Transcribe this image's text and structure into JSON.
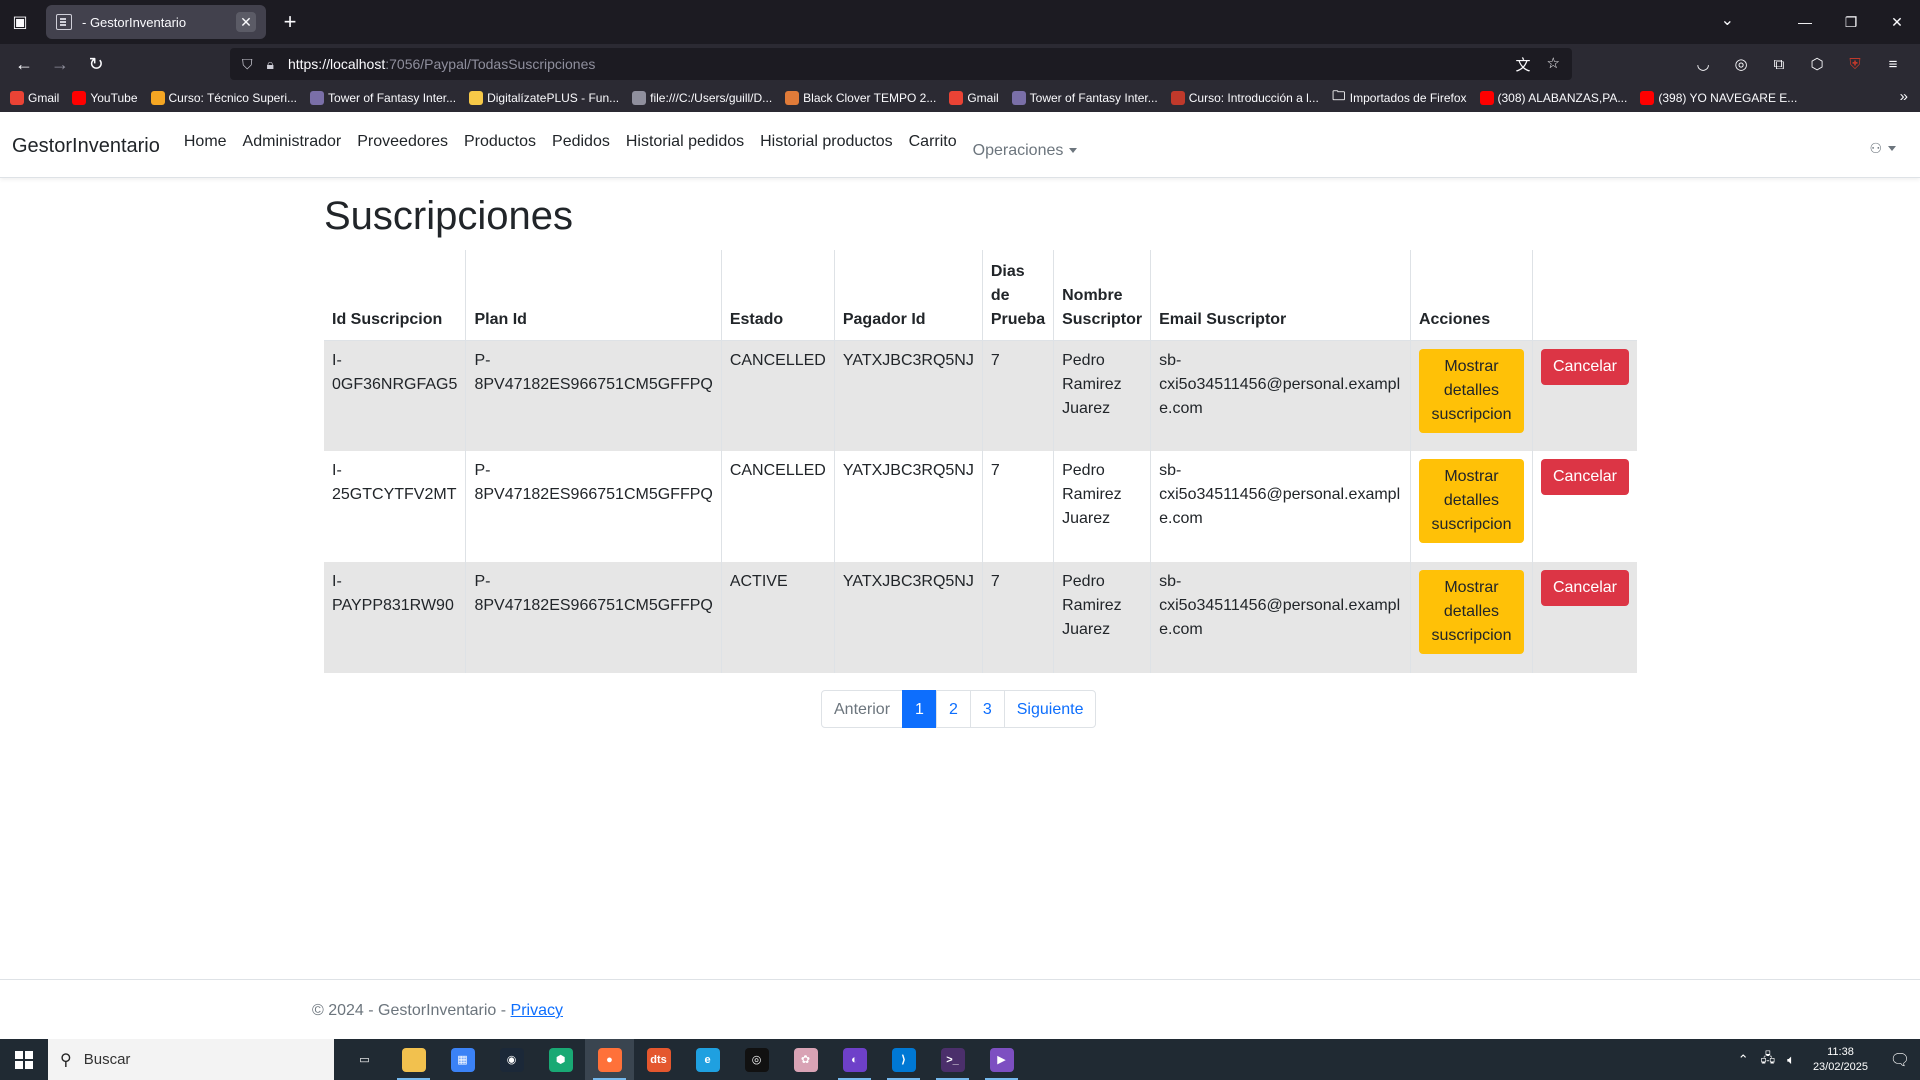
{
  "browser": {
    "tab_title": "- GestorInventario",
    "url_host": "https://localhost",
    "url_rest": ":7056/Paypal/TodasSuscripciones",
    "bookmarks": [
      {
        "label": "Gmail",
        "color": "#ea4335",
        "icon": "gmail-icon"
      },
      {
        "label": "YouTube",
        "color": "#ff0000",
        "icon": "youtube-icon"
      },
      {
        "label": "Curso: Técnico Superi...",
        "color": "#f5a623",
        "icon": "course-icon"
      },
      {
        "label": "Tower of Fantasy Inter...",
        "color": "#7a6fa8",
        "icon": "game-icon"
      },
      {
        "label": "DigitalízatePLUS - Fun...",
        "color": "#f7c948",
        "icon": "digital-icon"
      },
      {
        "label": "file:///C:/Users/guill/D...",
        "color": "#8f8f9d",
        "icon": "globe-icon"
      },
      {
        "label": "Black Clover TEMPO 2...",
        "color": "#e07b39",
        "icon": "fox-icon"
      },
      {
        "label": "Gmail",
        "color": "#ea4335",
        "icon": "gmail-icon"
      },
      {
        "label": "Tower of Fantasy Inter...",
        "color": "#7a6fa8",
        "icon": "game-icon"
      },
      {
        "label": "Curso: Introducción a l...",
        "color": "#c0392b",
        "icon": "course-icon"
      },
      {
        "label": "Importados de Firefox",
        "color": "transparent",
        "icon": "folder-icon"
      },
      {
        "label": "(308) ALABANZAS,PA...",
        "color": "#ff0000",
        "icon": "youtube-icon"
      },
      {
        "label": "(398) YO NAVEGARE E...",
        "color": "#ff0000",
        "icon": "youtube-icon"
      }
    ]
  },
  "site": {
    "brand": "GestorInventario",
    "nav": [
      "Home",
      "Administrador",
      "Proveedores",
      "Productos",
      "Pedidos",
      "Historial pedidos",
      "Historial productos",
      "Carrito"
    ],
    "dropdown": "Operaciones"
  },
  "page": {
    "title": "Suscripciones",
    "columns": [
      "Id Suscripcion",
      "Plan Id",
      "Estado",
      "Pagador Id",
      "Dias de Prueba",
      "Nombre Suscriptor",
      "Email Suscriptor",
      "Acciones",
      ""
    ],
    "rows": [
      {
        "id": "I-0GF36NRGFAG5",
        "plan": "P-8PV47182ES966751CM5GFFPQ",
        "estado": "CANCELLED",
        "pagador": "YATXJBC3RQ5NJ",
        "dias": "7",
        "nombre": "Pedro Ramirez Juarez",
        "email": "sb-cxi5o34511456@personal.example.com",
        "btn_details": "Mostrar detalles suscripcion",
        "btn_cancel": "Cancelar"
      },
      {
        "id": "I-25GTCYTFV2MT",
        "plan": "P-8PV47182ES966751CM5GFFPQ",
        "estado": "CANCELLED",
        "pagador": "YATXJBC3RQ5NJ",
        "dias": "7",
        "nombre": "Pedro Ramirez Juarez",
        "email": "sb-cxi5o34511456@personal.example.com",
        "btn_details": "Mostrar detalles suscripcion",
        "btn_cancel": "Cancelar"
      },
      {
        "id": "I-PAYPP831RW90",
        "plan": "P-8PV47182ES966751CM5GFFPQ",
        "estado": "ACTIVE",
        "pagador": "YATXJBC3RQ5NJ",
        "dias": "7",
        "nombre": "Pedro Ramirez Juarez",
        "email": "sb-cxi5o34511456@personal.example.com",
        "btn_details": "Mostrar detalles suscripcion",
        "btn_cancel": "Cancelar"
      }
    ],
    "pagination": {
      "prev": "Anterior",
      "pages": [
        "1",
        "2",
        "3"
      ],
      "active": "1",
      "next": "Siguiente"
    }
  },
  "footer": {
    "text": "© 2024 - GestorInventario - ",
    "link": "Privacy"
  },
  "taskbar": {
    "search_placeholder": "Buscar",
    "time": "11:38",
    "date": "23/02/2025",
    "apps": [
      {
        "name": "task-view-icon",
        "color": "transparent",
        "glyph": "▭"
      },
      {
        "name": "file-explorer-icon",
        "color": "#f2c14e",
        "glyph": ""
      },
      {
        "name": "store-icon",
        "color": "#3b82f6",
        "glyph": "▦"
      },
      {
        "name": "steam-icon",
        "color": "#1b2838",
        "glyph": "◉"
      },
      {
        "name": "kaspersky-icon",
        "color": "#19a974",
        "glyph": "⬢"
      },
      {
        "name": "firefox-icon",
        "color": "#ff7139",
        "glyph": "●"
      },
      {
        "name": "dts-icon",
        "color": "#e4572e",
        "glyph": "dts"
      },
      {
        "name": "edge-icon",
        "color": "#1fa0e0",
        "glyph": "e"
      },
      {
        "name": "media-icon",
        "color": "#111111",
        "glyph": "◎"
      },
      {
        "name": "anime-app-icon",
        "color": "#d9a3b5",
        "glyph": "✿"
      },
      {
        "name": "github-icon",
        "color": "#6e40c9",
        "glyph": "◐"
      },
      {
        "name": "vscode-icon",
        "color": "#0078d4",
        "glyph": "⟩"
      },
      {
        "name": "terminal-icon",
        "color": "#4b2f6b",
        "glyph": ">_"
      },
      {
        "name": "visual-studio-icon",
        "color": "#7d4fc1",
        "glyph": "▶"
      }
    ]
  }
}
